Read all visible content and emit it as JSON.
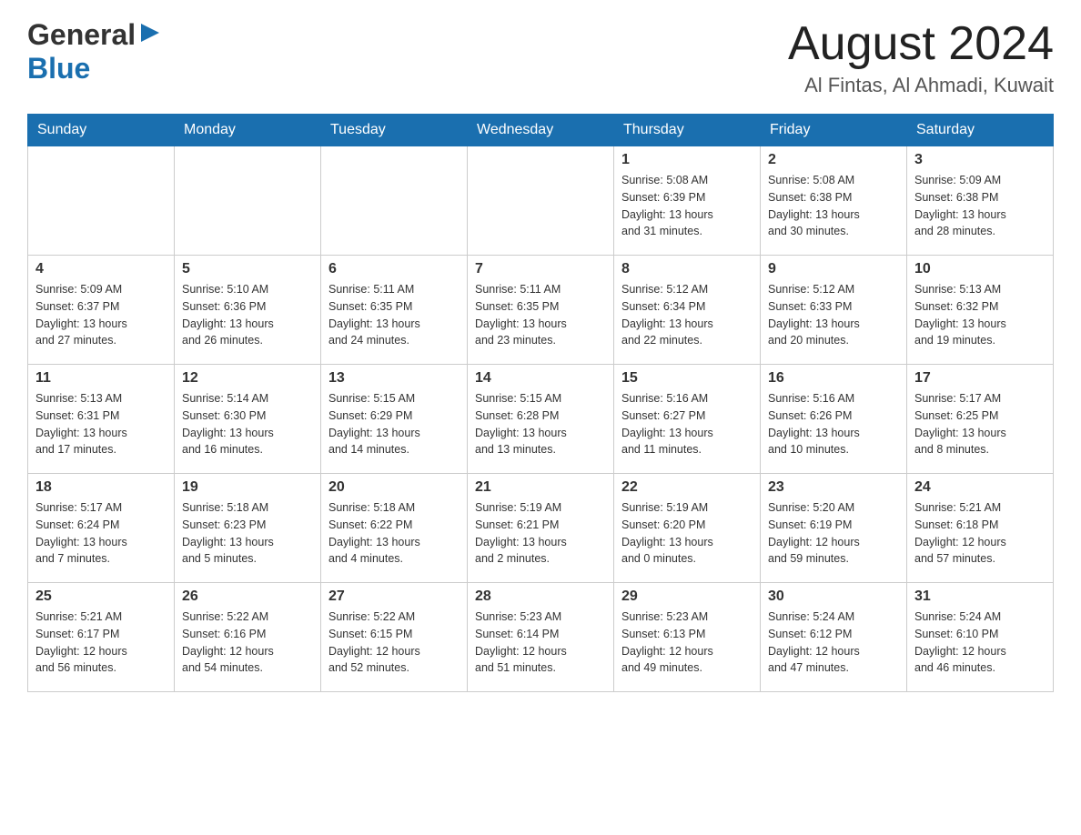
{
  "header": {
    "logo_general": "General",
    "logo_blue": "Blue",
    "main_title": "August 2024",
    "subtitle": "Al Fintas, Al Ahmadi, Kuwait"
  },
  "days_of_week": [
    "Sunday",
    "Monday",
    "Tuesday",
    "Wednesday",
    "Thursday",
    "Friday",
    "Saturday"
  ],
  "weeks": [
    {
      "cells": [
        {
          "num": "",
          "info": ""
        },
        {
          "num": "",
          "info": ""
        },
        {
          "num": "",
          "info": ""
        },
        {
          "num": "",
          "info": ""
        },
        {
          "num": "1",
          "info": "Sunrise: 5:08 AM\nSunset: 6:39 PM\nDaylight: 13 hours\nand 31 minutes."
        },
        {
          "num": "2",
          "info": "Sunrise: 5:08 AM\nSunset: 6:38 PM\nDaylight: 13 hours\nand 30 minutes."
        },
        {
          "num": "3",
          "info": "Sunrise: 5:09 AM\nSunset: 6:38 PM\nDaylight: 13 hours\nand 28 minutes."
        }
      ]
    },
    {
      "cells": [
        {
          "num": "4",
          "info": "Sunrise: 5:09 AM\nSunset: 6:37 PM\nDaylight: 13 hours\nand 27 minutes."
        },
        {
          "num": "5",
          "info": "Sunrise: 5:10 AM\nSunset: 6:36 PM\nDaylight: 13 hours\nand 26 minutes."
        },
        {
          "num": "6",
          "info": "Sunrise: 5:11 AM\nSunset: 6:35 PM\nDaylight: 13 hours\nand 24 minutes."
        },
        {
          "num": "7",
          "info": "Sunrise: 5:11 AM\nSunset: 6:35 PM\nDaylight: 13 hours\nand 23 minutes."
        },
        {
          "num": "8",
          "info": "Sunrise: 5:12 AM\nSunset: 6:34 PM\nDaylight: 13 hours\nand 22 minutes."
        },
        {
          "num": "9",
          "info": "Sunrise: 5:12 AM\nSunset: 6:33 PM\nDaylight: 13 hours\nand 20 minutes."
        },
        {
          "num": "10",
          "info": "Sunrise: 5:13 AM\nSunset: 6:32 PM\nDaylight: 13 hours\nand 19 minutes."
        }
      ]
    },
    {
      "cells": [
        {
          "num": "11",
          "info": "Sunrise: 5:13 AM\nSunset: 6:31 PM\nDaylight: 13 hours\nand 17 minutes."
        },
        {
          "num": "12",
          "info": "Sunrise: 5:14 AM\nSunset: 6:30 PM\nDaylight: 13 hours\nand 16 minutes."
        },
        {
          "num": "13",
          "info": "Sunrise: 5:15 AM\nSunset: 6:29 PM\nDaylight: 13 hours\nand 14 minutes."
        },
        {
          "num": "14",
          "info": "Sunrise: 5:15 AM\nSunset: 6:28 PM\nDaylight: 13 hours\nand 13 minutes."
        },
        {
          "num": "15",
          "info": "Sunrise: 5:16 AM\nSunset: 6:27 PM\nDaylight: 13 hours\nand 11 minutes."
        },
        {
          "num": "16",
          "info": "Sunrise: 5:16 AM\nSunset: 6:26 PM\nDaylight: 13 hours\nand 10 minutes."
        },
        {
          "num": "17",
          "info": "Sunrise: 5:17 AM\nSunset: 6:25 PM\nDaylight: 13 hours\nand 8 minutes."
        }
      ]
    },
    {
      "cells": [
        {
          "num": "18",
          "info": "Sunrise: 5:17 AM\nSunset: 6:24 PM\nDaylight: 13 hours\nand 7 minutes."
        },
        {
          "num": "19",
          "info": "Sunrise: 5:18 AM\nSunset: 6:23 PM\nDaylight: 13 hours\nand 5 minutes."
        },
        {
          "num": "20",
          "info": "Sunrise: 5:18 AM\nSunset: 6:22 PM\nDaylight: 13 hours\nand 4 minutes."
        },
        {
          "num": "21",
          "info": "Sunrise: 5:19 AM\nSunset: 6:21 PM\nDaylight: 13 hours\nand 2 minutes."
        },
        {
          "num": "22",
          "info": "Sunrise: 5:19 AM\nSunset: 6:20 PM\nDaylight: 13 hours\nand 0 minutes."
        },
        {
          "num": "23",
          "info": "Sunrise: 5:20 AM\nSunset: 6:19 PM\nDaylight: 12 hours\nand 59 minutes."
        },
        {
          "num": "24",
          "info": "Sunrise: 5:21 AM\nSunset: 6:18 PM\nDaylight: 12 hours\nand 57 minutes."
        }
      ]
    },
    {
      "cells": [
        {
          "num": "25",
          "info": "Sunrise: 5:21 AM\nSunset: 6:17 PM\nDaylight: 12 hours\nand 56 minutes."
        },
        {
          "num": "26",
          "info": "Sunrise: 5:22 AM\nSunset: 6:16 PM\nDaylight: 12 hours\nand 54 minutes."
        },
        {
          "num": "27",
          "info": "Sunrise: 5:22 AM\nSunset: 6:15 PM\nDaylight: 12 hours\nand 52 minutes."
        },
        {
          "num": "28",
          "info": "Sunrise: 5:23 AM\nSunset: 6:14 PM\nDaylight: 12 hours\nand 51 minutes."
        },
        {
          "num": "29",
          "info": "Sunrise: 5:23 AM\nSunset: 6:13 PM\nDaylight: 12 hours\nand 49 minutes."
        },
        {
          "num": "30",
          "info": "Sunrise: 5:24 AM\nSunset: 6:12 PM\nDaylight: 12 hours\nand 47 minutes."
        },
        {
          "num": "31",
          "info": "Sunrise: 5:24 AM\nSunset: 6:10 PM\nDaylight: 12 hours\nand 46 minutes."
        }
      ]
    }
  ]
}
